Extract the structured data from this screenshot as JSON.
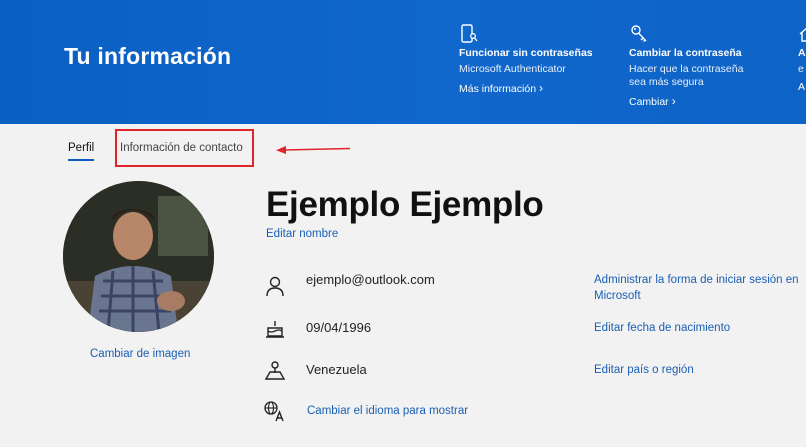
{
  "header": {
    "title": "Tu información",
    "promos": [
      {
        "icon": "phone-key-icon",
        "title": "Funcionar sin contraseñas",
        "desc": "Microsoft Authenticator",
        "link": "Más información"
      },
      {
        "icon": "key-icon",
        "title": "Cambiar la contraseña",
        "desc": "Hacer que la contraseña sea más segura",
        "link": "Cambiar"
      },
      {
        "icon": "home-icon",
        "title": "A",
        "desc": "e",
        "link": "A"
      }
    ]
  },
  "tabs": {
    "profile": "Perfil",
    "contact": "Información de contacto"
  },
  "profile": {
    "change_photo": "Cambiar de imagen",
    "name": "Ejemplo Ejemplo",
    "edit_name": "Editar nombre",
    "email": "ejemplo@outlook.com",
    "email_action": "Administrar la forma de iniciar sesión en Microsoft",
    "birthdate": "09/04/1996",
    "birthdate_action": "Editar fecha de nacimiento",
    "country": "Venezuela",
    "country_action": "Editar país o región",
    "language_action": "Cambiar el idioma para mostrar"
  },
  "colors": {
    "header_blue": "#0a5fc2",
    "link_blue": "#1a5fb4",
    "annotation_red": "#e0242a"
  }
}
